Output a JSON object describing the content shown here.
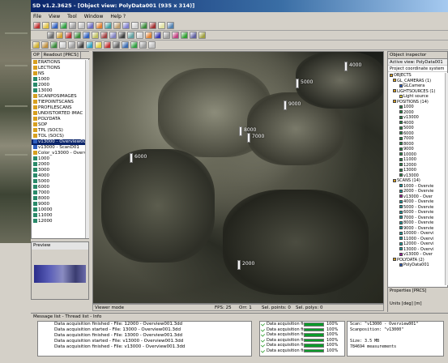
{
  "window": {
    "title": "SD v1.2.3625 - [Object view: PolyData001 (935 x 314)]"
  },
  "menu": [
    "File",
    "View",
    "Tool",
    "Window",
    "Help ?"
  ],
  "left_panel": {
    "tabs": [
      "OP",
      "Readout [PRCS]"
    ],
    "items": [
      "ERATIONS",
      "LECTIONS",
      "NS",
      "1000",
      "2000",
      "13000",
      "SCANPOSIMAGES",
      "TIEPOINTSCANS",
      "PROFILESCANS",
      "UNDISTORTED IMAC",
      "POLYDATA",
      "SOP",
      "TPL (SOCS)",
      "TOL (SOCS)",
      "v13000 - Overview001",
      "v13000 - ScanD01",
      "Color_v13000 - Overvi",
      "1000",
      "2000",
      "3000",
      "4000",
      "5000",
      "6000",
      "7000",
      "8000",
      "9000",
      "10000",
      "11000",
      "12000"
    ],
    "selected_index": 14
  },
  "preview": {
    "title": "Preview"
  },
  "viewer": {
    "position_labels": [
      "4000",
      "6000",
      "5000",
      "7000",
      "8000",
      "2000",
      "9000"
    ],
    "status": {
      "mode": "Viewer mode",
      "fps": "FPS: 25",
      "orr": "Orr: 1",
      "points": "Sel. points: 0",
      "polys": "Sel. polys: 0"
    }
  },
  "inspector": {
    "tab": "Object inspector",
    "active_view": "Active view: PolyData001",
    "coord_system": "Project coordinate system",
    "tree": [
      {
        "label": "OBJECTS",
        "indent": 0,
        "color": "#d8a020"
      },
      {
        "label": "GL_CAMERAS (1)",
        "indent": 1,
        "color": "#d8a020"
      },
      {
        "label": "GLCamera",
        "indent": 3,
        "color": "#3060c0"
      },
      {
        "label": "LIGHTSOURCES (1)",
        "indent": 1,
        "color": "#d8a020"
      },
      {
        "label": "Light source",
        "indent": 3,
        "color": "#e0d040"
      },
      {
        "label": "POSITIONS (14)",
        "indent": 1,
        "color": "#d8a020"
      },
      {
        "label": "1000",
        "indent": 3,
        "color": "#2a8a4a"
      },
      {
        "label": "2000",
        "indent": 3,
        "color": "#2a8a4a"
      },
      {
        "label": "v13000",
        "indent": 3,
        "color": "#2a8a4a"
      },
      {
        "label": "4000",
        "indent": 3,
        "color": "#2a8a4a"
      },
      {
        "label": "5000",
        "indent": 3,
        "color": "#2a8a4a"
      },
      {
        "label": "6000",
        "indent": 3,
        "color": "#2a8a4a"
      },
      {
        "label": "7000",
        "indent": 3,
        "color": "#2a8a4a"
      },
      {
        "label": "8000",
        "indent": 3,
        "color": "#2a8a4a"
      },
      {
        "label": "9000",
        "indent": 3,
        "color": "#2a8a4a"
      },
      {
        "label": "10000",
        "indent": 3,
        "color": "#2a8a4a"
      },
      {
        "label": "11000",
        "indent": 3,
        "color": "#2a8a4a"
      },
      {
        "label": "12000",
        "indent": 3,
        "color": "#2a8a4a"
      },
      {
        "label": "13000",
        "indent": 3,
        "color": "#2a8a4a"
      },
      {
        "label": "v13000",
        "indent": 3,
        "color": "#2a8a4a"
      },
      {
        "label": "SCANS (14)",
        "indent": 1,
        "color": "#d8a020"
      },
      {
        "label": "1000 - Overvie",
        "indent": 3,
        "color": "#20a0a0"
      },
      {
        "label": "2000 - Overvie",
        "indent": 3,
        "color": "#20a0a0"
      },
      {
        "label": "v13000 - Over",
        "indent": 3,
        "color": "#a020a0"
      },
      {
        "label": "4000 - Overvie",
        "indent": 3,
        "color": "#20a0a0"
      },
      {
        "label": "5000 - Overvie",
        "indent": 3,
        "color": "#20a0a0"
      },
      {
        "label": "6000 - Overvie",
        "indent": 3,
        "color": "#20a0a0"
      },
      {
        "label": "7000 - Overvie",
        "indent": 3,
        "color": "#20a0a0"
      },
      {
        "label": "8000 - Overvie",
        "indent": 3,
        "color": "#20a0a0"
      },
      {
        "label": "9000 - Overvie",
        "indent": 3,
        "color": "#20a0a0"
      },
      {
        "label": "10000 - Overvi",
        "indent": 3,
        "color": "#20a0a0"
      },
      {
        "label": "11000 - Overvi",
        "indent": 3,
        "color": "#20a0a0"
      },
      {
        "label": "12000 - Overvi",
        "indent": 3,
        "color": "#20a0a0"
      },
      {
        "label": "13000 - Overvi",
        "indent": 3,
        "color": "#20a0a0"
      },
      {
        "label": "v13000 - Over",
        "indent": 3,
        "color": "#a020a0"
      },
      {
        "label": "POLYDATA (2)",
        "indent": 1,
        "color": "#d8a020"
      },
      {
        "label": "PolyData001",
        "indent": 3,
        "color": "#3060c0"
      }
    ],
    "properties_title": "Properties [PRCS]",
    "units": "Units [deg] [m]"
  },
  "messages": {
    "tabs": "Message list - Thread list - Info",
    "log": [
      "Data acquisition finished - File: 12000 - Overview001.3dd",
      "Data acquisition started - File: 13000 - Overview001.3dd",
      "Data acquisition finished - File: 13000 - Overview001.3dd",
      "Data acquisition started - File: v13000 - Overview001.3dd",
      "Data acquisition finished - File: v13000 - Overview001.3dd"
    ],
    "progress": [
      {
        "label": "Data acquisition firs...",
        "pct_text": "100%",
        "pct": 1.0
      },
      {
        "label": "Data acquisition firs...",
        "pct_text": "100%",
        "pct": 1.0
      },
      {
        "label": "Data acquisition firs...",
        "pct_text": "100%",
        "pct": 1.0
      },
      {
        "label": "Data acquisition firs...",
        "pct_text": "100%",
        "pct": 1.0
      },
      {
        "label": "Data acquisition firs...",
        "pct_text": "100%",
        "pct": 1.0
      },
      {
        "label": "Data acquisition firs...",
        "pct_text": "100%",
        "pct": 1.0
      }
    ],
    "info": [
      "Scan: \"v13000 - Overview001\"",
      "Scanposition: \"v13000\"",
      "",
      "Size: 3.5 MB",
      "784694 measurements"
    ]
  }
}
